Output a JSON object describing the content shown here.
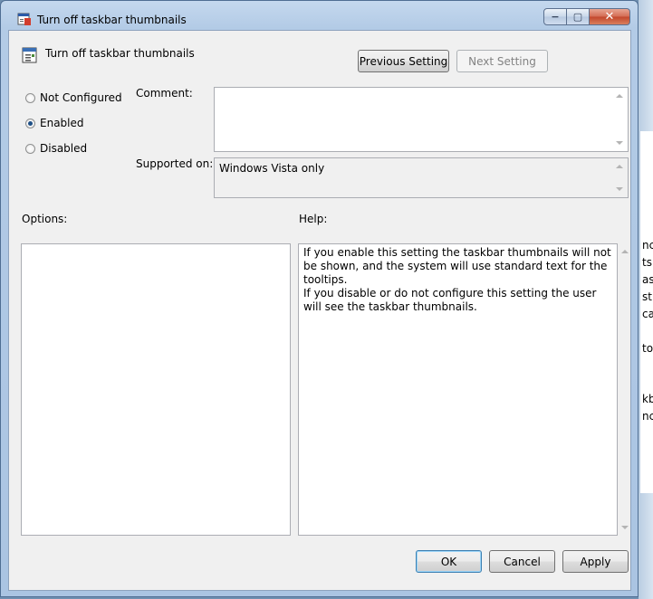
{
  "window": {
    "title": "Turn off taskbar thumbnails",
    "caption": {
      "minimize": "−",
      "maximize": "▢",
      "close": "✕"
    }
  },
  "setting": {
    "title": "Turn off taskbar thumbnails",
    "previous_label": "Previous Setting",
    "next_label": "Next Setting"
  },
  "state": {
    "options": [
      "Not Configured",
      "Enabled",
      "Disabled"
    ],
    "selected": "Enabled"
  },
  "labels": {
    "comment": "Comment:",
    "supported_on": "Supported on:",
    "options": "Options:",
    "help": "Help:"
  },
  "comment_value": "",
  "supported_on_value": "Windows Vista only",
  "help": {
    "paragraphs": [
      "If you enable this setting the taskbar thumbnails will not be shown, and the system will use standard text for the tooltips.",
      "If you disable or do not configure this setting the user will see the taskbar thumbnails."
    ]
  },
  "buttons": {
    "ok": "OK",
    "cancel": "Cancel",
    "apply": "Apply"
  },
  "background_fragments": [
    "nc",
    "ts",
    "as",
    "st",
    "ca",
    "to",
    "kb",
    "nc"
  ],
  "colors": {
    "accent": "#3c7fb1",
    "title_bar": "#b3cbe6",
    "close": "#c2472b"
  }
}
